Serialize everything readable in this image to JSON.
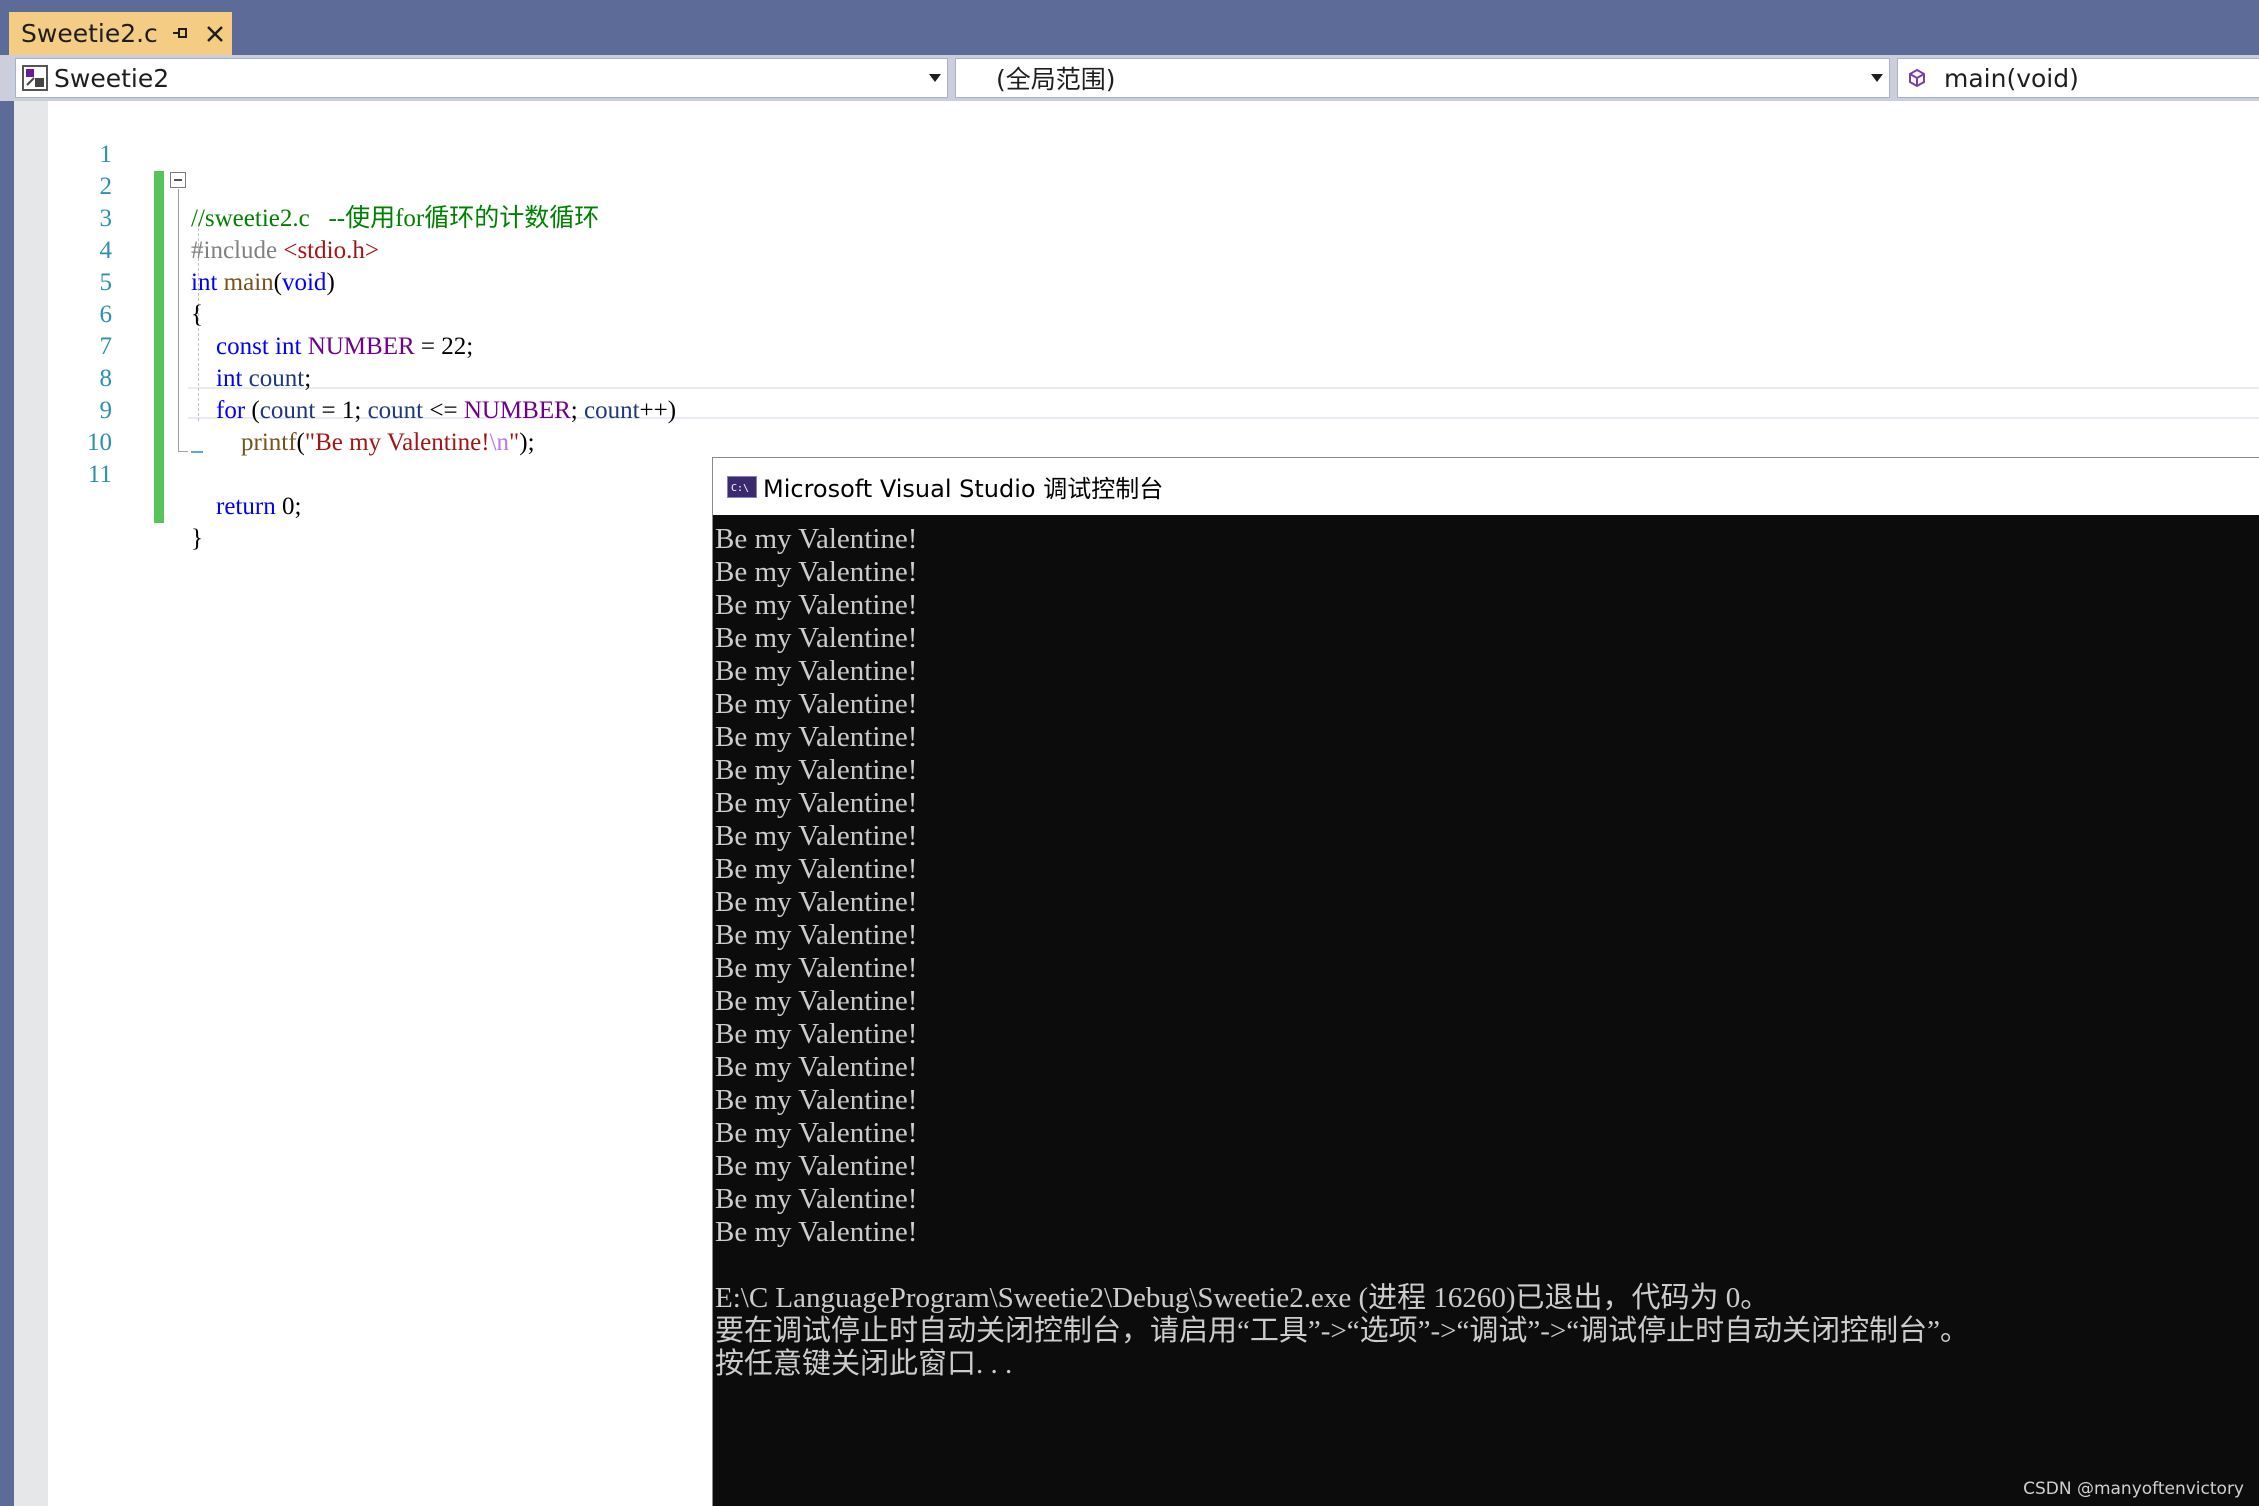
{
  "tab": {
    "title": "Sweetie2.c"
  },
  "nav": {
    "project": "Sweetie2",
    "scope": "(全局范围)",
    "member": "main(void)"
  },
  "editor": {
    "lines": [
      {
        "number": "1"
      },
      {
        "number": "2"
      },
      {
        "number": "3"
      },
      {
        "number": "4"
      },
      {
        "number": "5"
      },
      {
        "number": "6"
      },
      {
        "number": "7"
      },
      {
        "number": "8"
      },
      {
        "number": "9"
      },
      {
        "number": "10"
      },
      {
        "number": "11"
      }
    ],
    "code": {
      "l1_comment": "//sweetie2.c   --使用for循环的计数循环",
      "l2_pre": "#include ",
      "l2_header": "<stdio.h>",
      "l3_kw_int": "int",
      "l3_fn": "main",
      "l3_open": "(",
      "l3_kw_void": "void",
      "l3_close": ")",
      "l4_brace": "{",
      "l5_kw_const": "const",
      "l5_kw_int": "int",
      "l5_macro": "NUMBER",
      "l5_rest": " = 22;",
      "l6_kw_int": "int",
      "l6_id": "count",
      "l6_semi": ";",
      "l7_kw_for": "for",
      "l7_p1": " (",
      "l7_id1": "count",
      "l7_p2": " = 1; ",
      "l7_id2": "count",
      "l7_p3": " <= ",
      "l7_macro": "NUMBER",
      "l7_p4": "; ",
      "l7_id3": "count",
      "l7_p5": "++)",
      "l8_fn": "printf",
      "l8_open": "(",
      "l8_str": "\"Be my Valentine!",
      "l8_esc": "\\n",
      "l8_strend": "\"",
      "l8_close": ");",
      "l10_kw_return": "return",
      "l10_rest": " 0;",
      "l11_brace": "}"
    }
  },
  "console": {
    "title": "Microsoft Visual Studio 调试控制台",
    "output_lines": [
      "Be my Valentine!",
      "Be my Valentine!",
      "Be my Valentine!",
      "Be my Valentine!",
      "Be my Valentine!",
      "Be my Valentine!",
      "Be my Valentine!",
      "Be my Valentine!",
      "Be my Valentine!",
      "Be my Valentine!",
      "Be my Valentine!",
      "Be my Valentine!",
      "Be my Valentine!",
      "Be my Valentine!",
      "Be my Valentine!",
      "Be my Valentine!",
      "Be my Valentine!",
      "Be my Valentine!",
      "Be my Valentine!",
      "Be my Valentine!",
      "Be my Valentine!",
      "Be my Valentine!"
    ],
    "exit_message": "E:\\C LanguageProgram\\Sweetie2\\Debug\\Sweetie2.exe (进程 16260)已退出，代码为 0。",
    "hint_message": "要在调试停止时自动关闭控制台，请启用“工具”->“选项”->“调试”->“调试停止时自动关闭控制台”。",
    "press_key": "按任意键关闭此窗口. . ."
  },
  "watermark": "CSDN @manyoftenvictory"
}
